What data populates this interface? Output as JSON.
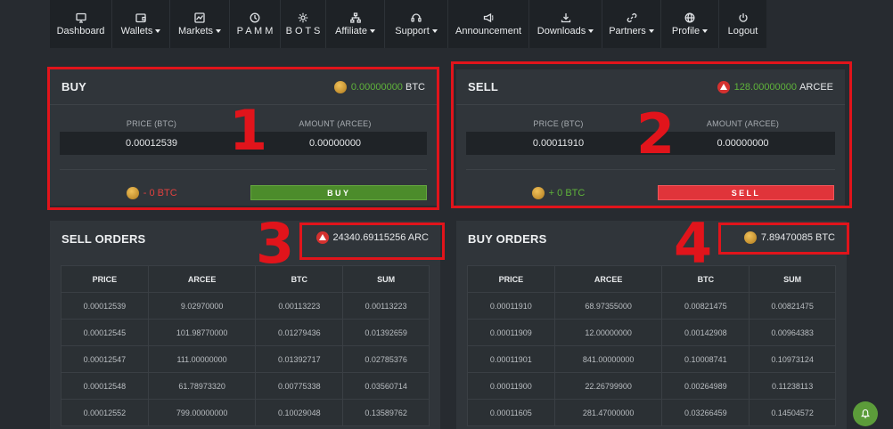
{
  "nav": [
    {
      "icon": "monitor-icon",
      "label": "Dashboard",
      "dropdown": false
    },
    {
      "icon": "wallet-icon",
      "label": "Wallets",
      "dropdown": true
    },
    {
      "icon": "chart-icon",
      "label": "Markets",
      "dropdown": true
    },
    {
      "icon": "clock-icon",
      "label": "P A M M",
      "dropdown": false
    },
    {
      "icon": "gear-icon",
      "label": "B O T S",
      "dropdown": false
    },
    {
      "icon": "sitemap-icon",
      "label": "Affiliate",
      "dropdown": true
    },
    {
      "icon": "headset-icon",
      "label": "Support",
      "dropdown": true
    },
    {
      "icon": "megaphone-icon",
      "label": "Announcement",
      "dropdown": false
    },
    {
      "icon": "download-icon",
      "label": "Downloads",
      "dropdown": true
    },
    {
      "icon": "link-icon",
      "label": "Partners",
      "dropdown": true
    },
    {
      "icon": "globe-icon",
      "label": "Profile",
      "dropdown": true
    },
    {
      "icon": "power-icon",
      "label": "Logout",
      "dropdown": false
    }
  ],
  "buy_panel": {
    "title": "BUY",
    "balance_value": "0.00000000",
    "balance_unit": "BTC",
    "price_label": "PRICE (BTC)",
    "price_value": "0.00012539",
    "amount_label": "AMOUNT (ARCEE)",
    "amount_value": "0.00000000",
    "total": "- 0 BTC",
    "button_label": "BUY"
  },
  "sell_panel": {
    "title": "SELL",
    "balance_value": "128.00000000",
    "balance_unit": "ARCEE",
    "price_label": "PRICE (BTC)",
    "price_value": "0.00011910",
    "amount_label": "AMOUNT (ARCEE)",
    "amount_value": "0.00000000",
    "total": "+ 0 BTC",
    "button_label": "SELL"
  },
  "sell_orders": {
    "title": "SELL ORDERS",
    "total": "24340.69115256 ARC",
    "columns": [
      "PRICE",
      "ARCEE",
      "BTC",
      "SUM"
    ],
    "rows": [
      [
        "0.00012539",
        "9.02970000",
        "0.00113223",
        "0.00113223"
      ],
      [
        "0.00012545",
        "101.98770000",
        "0.01279436",
        "0.01392659"
      ],
      [
        "0.00012547",
        "111.00000000",
        "0.01392717",
        "0.02785376"
      ],
      [
        "0.00012548",
        "61.78973320",
        "0.00775338",
        "0.03560714"
      ],
      [
        "0.00012552",
        "799.00000000",
        "0.10029048",
        "0.13589762"
      ]
    ]
  },
  "buy_orders": {
    "title": "BUY ORDERS",
    "total": "7.89470085 BTC",
    "columns": [
      "PRICE",
      "ARCEE",
      "BTC",
      "SUM"
    ],
    "rows": [
      [
        "0.00011910",
        "68.97355000",
        "0.00821475",
        "0.00821475"
      ],
      [
        "0.00011909",
        "12.00000000",
        "0.00142908",
        "0.00964383"
      ],
      [
        "0.00011901",
        "841.00000000",
        "0.10008741",
        "0.10973124"
      ],
      [
        "0.00011900",
        "22.26799900",
        "0.00264989",
        "0.11238113"
      ],
      [
        "0.00011605",
        "281.47000000",
        "0.03266459",
        "0.14504572"
      ]
    ]
  },
  "annotations": [
    "1",
    "2",
    "3",
    "4"
  ],
  "colors": {
    "accent_green": "#5fb33a",
    "accent_red": "#e2413f",
    "annotation_red": "#e1141b"
  }
}
